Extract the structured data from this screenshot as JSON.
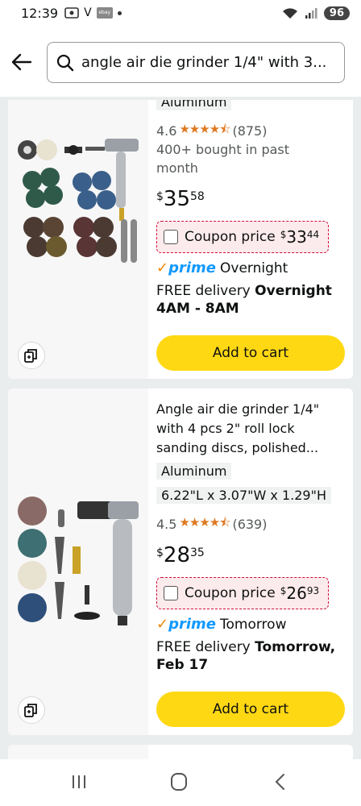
{
  "status": {
    "time": "12:39",
    "v_label": "V",
    "ebay_badge": "ebay",
    "battery": "96"
  },
  "search": {
    "query": "angle air die grinder 1/4\" with 3..."
  },
  "products": [
    {
      "material": "Aluminum",
      "rating": "4.6",
      "stars": "★★★★⯪",
      "reviews": "(875)",
      "bought": "400+ bought in past month",
      "price_symbol": "$",
      "price_whole": "35",
      "price_fraction": "58",
      "coupon_label": "Coupon price",
      "coupon_symbol": "$",
      "coupon_whole": "33",
      "coupon_fraction": "44",
      "prime_label": "prime",
      "prime_speed": "Overnight",
      "delivery_prefix": "FREE delivery",
      "delivery_bold": "Overnight 4AM - 8AM",
      "cart_label": "Add to cart"
    },
    {
      "title": "Angle air die grinder 1/4\" with 4 pcs 2\" roll lock sanding discs, polished...",
      "material": "Aluminum",
      "dimensions": "6.22\"L x 3.07\"W x 1.29\"H",
      "rating": "4.5",
      "stars": "★★★★⯪",
      "reviews": "(639)",
      "price_symbol": "$",
      "price_whole": "28",
      "price_fraction": "35",
      "coupon_label": "Coupon price",
      "coupon_symbol": "$",
      "coupon_whole": "26",
      "coupon_fraction": "93",
      "prime_label": "prime",
      "prime_speed": "Tomorrow",
      "delivery_prefix": "FREE delivery",
      "delivery_bold": "Tomorrow, Feb 17",
      "cart_label": "Add to cart"
    }
  ],
  "icons": {
    "back": "back-arrow-icon",
    "search": "search-icon",
    "compare": "compare-icon",
    "nav_recents": "recents-icon",
    "nav_home": "home-icon",
    "nav_back": "nav-back-icon"
  },
  "colors": {
    "cart_button": "#ffd814",
    "prime_blue": "#1399ff",
    "prime_check": "#f08804",
    "star": "#de7921",
    "coupon_border": "#cc0c39"
  }
}
